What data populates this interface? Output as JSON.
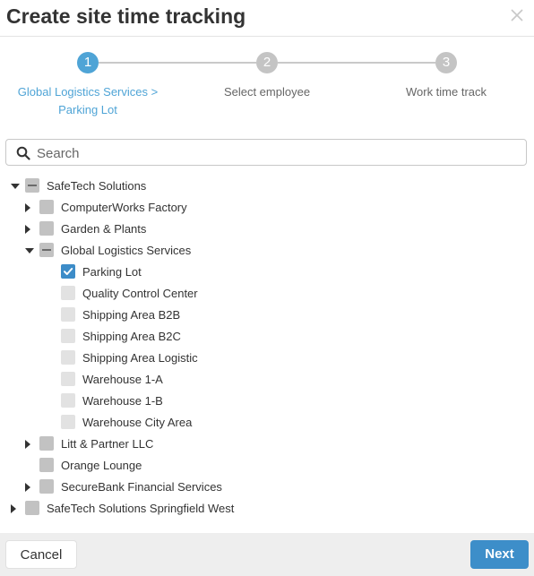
{
  "dialog": {
    "title": "Create site time tracking"
  },
  "stepper": {
    "steps": [
      {
        "number": "1",
        "label_line1": "Global Logistics Services >",
        "label_line2": "Parking Lot",
        "state": "active"
      },
      {
        "number": "2",
        "label_line1": "Select employee",
        "label_line2": "",
        "state": "inactive"
      },
      {
        "number": "3",
        "label_line1": "Work time track",
        "label_line2": "",
        "state": "inactive"
      }
    ]
  },
  "search": {
    "placeholder": "Search",
    "value": ""
  },
  "tree": [
    {
      "label": "SafeTech Solutions",
      "level": 0,
      "expander": "expanded",
      "check": "indeterminate"
    },
    {
      "label": "ComputerWorks Factory",
      "level": 1,
      "expander": "collapsed",
      "check": "unchecked"
    },
    {
      "label": "Garden & Plants",
      "level": 1,
      "expander": "collapsed",
      "check": "unchecked"
    },
    {
      "label": "Global Logistics Services",
      "level": 1,
      "expander": "expanded",
      "check": "indeterminate"
    },
    {
      "label": "Parking Lot",
      "level": 2,
      "expander": "none",
      "check": "checked"
    },
    {
      "label": "Quality Control Center",
      "level": 2,
      "expander": "none",
      "check": "disabled"
    },
    {
      "label": "Shipping Area B2B",
      "level": 2,
      "expander": "none",
      "check": "disabled"
    },
    {
      "label": "Shipping Area B2C",
      "level": 2,
      "expander": "none",
      "check": "disabled"
    },
    {
      "label": "Shipping Area Logistic",
      "level": 2,
      "expander": "none",
      "check": "disabled"
    },
    {
      "label": "Warehouse 1-A",
      "level": 2,
      "expander": "none",
      "check": "disabled"
    },
    {
      "label": "Warehouse 1-B",
      "level": 2,
      "expander": "none",
      "check": "disabled"
    },
    {
      "label": "Warehouse City Area",
      "level": 2,
      "expander": "none",
      "check": "disabled"
    },
    {
      "label": "Litt & Partner LLC",
      "level": 1,
      "expander": "collapsed",
      "check": "unchecked"
    },
    {
      "label": "Orange Lounge",
      "level": 1,
      "expander": "none",
      "check": "unchecked"
    },
    {
      "label": "SecureBank Financial Services",
      "level": 1,
      "expander": "collapsed",
      "check": "unchecked"
    },
    {
      "label": "SafeTech Solutions Springfield West",
      "level": 0,
      "expander": "collapsed",
      "check": "unchecked"
    }
  ],
  "footer": {
    "cancel_label": "Cancel",
    "next_label": "Next"
  },
  "colors": {
    "accent": "#3d8ec9",
    "active_step": "#4fa4d6",
    "inactive_step": "#c4c4c4"
  }
}
